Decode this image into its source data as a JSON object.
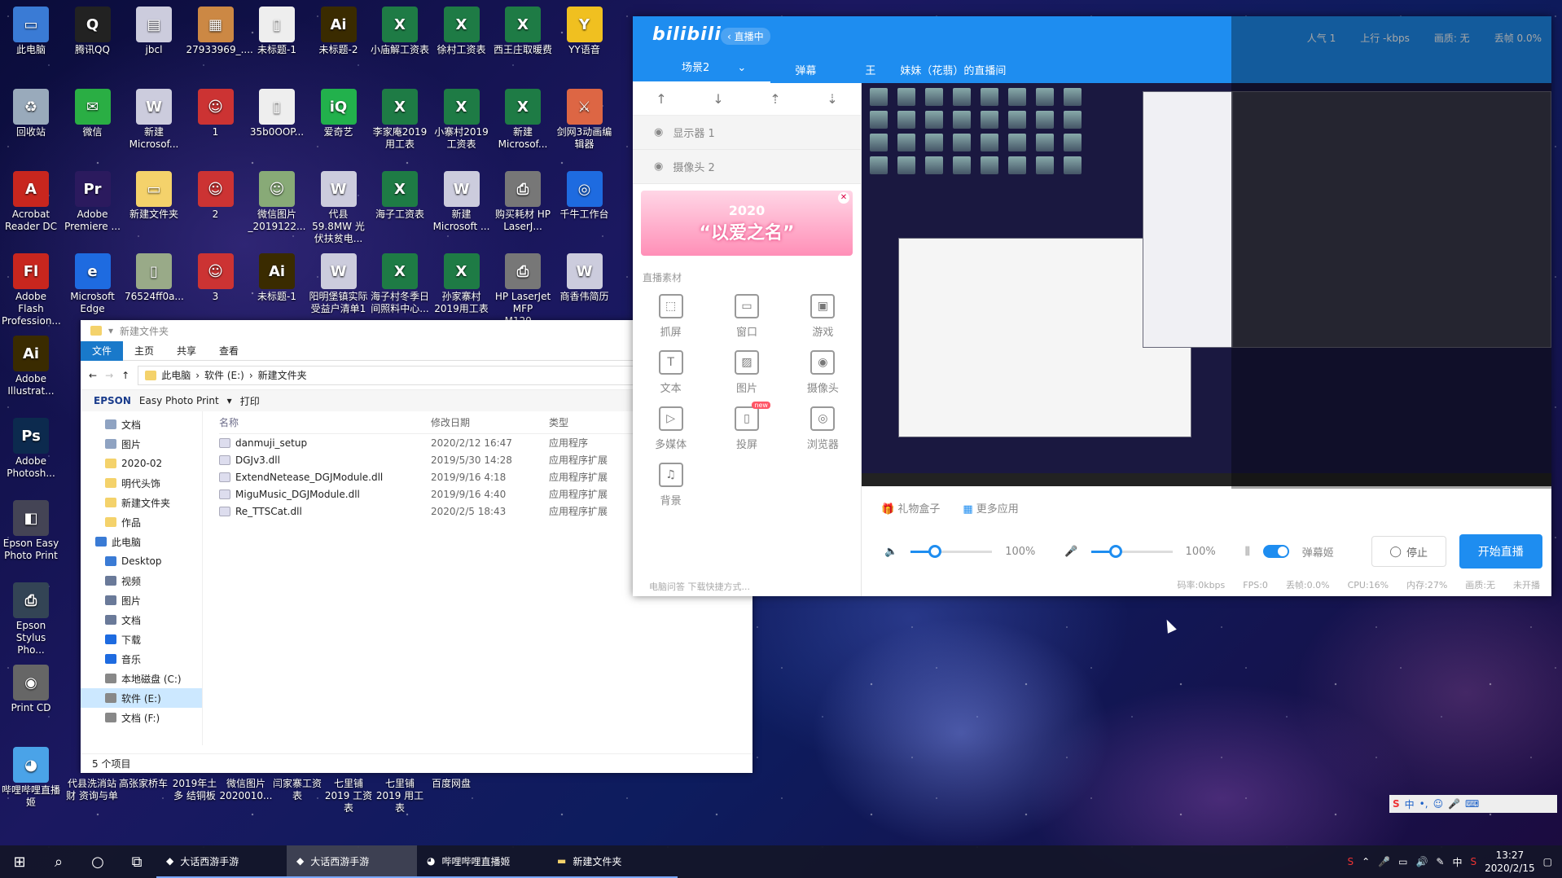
{
  "desktop": {
    "icons": [
      {
        "label": "此电脑",
        "color": "#3a7bd5",
        "glyph": "▭",
        "col": 0,
        "row": 0
      },
      {
        "label": "腾讯QQ",
        "color": "#222",
        "glyph": "Q",
        "col": 1,
        "row": 0
      },
      {
        "label": "jbcl",
        "color": "#ccd",
        "glyph": "▤",
        "col": 2,
        "row": 0
      },
      {
        "label": "27933969_....",
        "color": "#c84",
        "glyph": "▦",
        "col": 3,
        "row": 0
      },
      {
        "label": "未标题-1",
        "color": "#eee",
        "glyph": "▯",
        "col": 4,
        "row": 0
      },
      {
        "label": "未标题-2",
        "color": "#3a2b00",
        "glyph": "Ai",
        "col": 5,
        "row": 0
      },
      {
        "label": "小庙解工资表",
        "color": "#1e7b45",
        "glyph": "X",
        "col": 6,
        "row": 0
      },
      {
        "label": "徐村工资表",
        "color": "#1e7b45",
        "glyph": "X",
        "col": 7,
        "row": 0
      },
      {
        "label": "西王庄取暖费",
        "color": "#1e7b45",
        "glyph": "X",
        "col": 8,
        "row": 0
      },
      {
        "label": "YY语音",
        "color": "#f0c020",
        "glyph": "Y",
        "col": 9,
        "row": 0
      },
      {
        "label": "回收站",
        "color": "#9ab",
        "glyph": "♻",
        "col": 0,
        "row": 1
      },
      {
        "label": "微信",
        "color": "#2aae44",
        "glyph": "✉",
        "col": 1,
        "row": 1
      },
      {
        "label": "新建 Microsof...",
        "color": "#ccd",
        "glyph": "W",
        "col": 2,
        "row": 1
      },
      {
        "label": "1",
        "color": "#c33",
        "glyph": "☺",
        "col": 3,
        "row": 1
      },
      {
        "label": "35b0OOP...",
        "color": "#eee",
        "glyph": "▯",
        "col": 4,
        "row": 1
      },
      {
        "label": "爱奇艺",
        "color": "#22b14c",
        "glyph": "iQ",
        "col": 5,
        "row": 1
      },
      {
        "label": "李家庵2019 用工表",
        "color": "#1e7b45",
        "glyph": "X",
        "col": 6,
        "row": 1
      },
      {
        "label": "小寨村2019 工资表",
        "color": "#1e7b45",
        "glyph": "X",
        "col": 7,
        "row": 1
      },
      {
        "label": "新建 Microsof...",
        "color": "#1e7b45",
        "glyph": "X",
        "col": 8,
        "row": 1
      },
      {
        "label": "剑网3动画编 辑器",
        "color": "#d64",
        "glyph": "⚔",
        "col": 9,
        "row": 1
      },
      {
        "label": "Acrobat Reader DC",
        "color": "#c8261e",
        "glyph": "A",
        "col": 0,
        "row": 2
      },
      {
        "label": "Adobe Premiere ...",
        "color": "#2b1a5e",
        "glyph": "Pr",
        "col": 1,
        "row": 2
      },
      {
        "label": "新建文件夹",
        "color": "#f4d26b",
        "glyph": "▭",
        "col": 2,
        "row": 2
      },
      {
        "label": "2",
        "color": "#c33",
        "glyph": "☺",
        "col": 3,
        "row": 2
      },
      {
        "label": "微信图片 _2019122...",
        "color": "#8a7",
        "glyph": "☺",
        "col": 4,
        "row": 2
      },
      {
        "label": "代县59.8MW 光伏扶贫电...",
        "color": "#ccd",
        "glyph": "W",
        "col": 5,
        "row": 2
      },
      {
        "label": "海子工资表",
        "color": "#1e7b45",
        "glyph": "X",
        "col": 6,
        "row": 2
      },
      {
        "label": "新建 Microsoft ...",
        "color": "#ccd",
        "glyph": "W",
        "col": 7,
        "row": 2
      },
      {
        "label": "购买耗材 HP LaserJ...",
        "color": "#777",
        "glyph": "⎙",
        "col": 8,
        "row": 2
      },
      {
        "label": "千牛工作台",
        "color": "#1e6be0",
        "glyph": "◎",
        "col": 9,
        "row": 2
      },
      {
        "label": "Adobe Flash Profession...",
        "color": "#c8261e",
        "glyph": "Fl",
        "col": 0,
        "row": 3
      },
      {
        "label": "Microsoft Edge",
        "color": "#1e6be0",
        "glyph": "e",
        "col": 1,
        "row": 3
      },
      {
        "label": "76524ff0a...",
        "color": "#9a8",
        "glyph": "▯",
        "col": 2,
        "row": 3
      },
      {
        "label": "3",
        "color": "#c33",
        "glyph": "☺",
        "col": 3,
        "row": 3
      },
      {
        "label": "未标题-1",
        "color": "#3a2b00",
        "glyph": "Ai",
        "col": 4,
        "row": 3
      },
      {
        "label": "阳明堡镇实际 受益户清单1",
        "color": "#ccd",
        "glyph": "W",
        "col": 5,
        "row": 3
      },
      {
        "label": "海子村冬季日 间照料中心...",
        "color": "#1e7b45",
        "glyph": "X",
        "col": 6,
        "row": 3
      },
      {
        "label": "孙家寨村 2019用工表",
        "color": "#1e7b45",
        "glyph": "X",
        "col": 7,
        "row": 3
      },
      {
        "label": "HP LaserJet MFP M129...",
        "color": "#777",
        "glyph": "⎙",
        "col": 8,
        "row": 3
      },
      {
        "label": "商香伟简历",
        "color": "#ccd",
        "glyph": "W",
        "col": 9,
        "row": 3
      },
      {
        "label": "Adobe Illustrat...",
        "color": "#3a2b00",
        "glyph": "Ai",
        "col": 0,
        "row": 4
      },
      {
        "label": "Adobe Photosh...",
        "color": "#0c2a4e",
        "glyph": "Ps",
        "col": 0,
        "row": 5
      },
      {
        "label": "Epson Easy Photo Print",
        "color": "#445",
        "glyph": "◧",
        "col": 0,
        "row": 6
      },
      {
        "label": "Epson Stylus Pho...",
        "color": "#345",
        "glyph": "⎙",
        "col": 0,
        "row": 7
      },
      {
        "label": "Print CD",
        "color": "#666",
        "glyph": "◉",
        "col": 0,
        "row": 8
      },
      {
        "label": "哔哩哔哩直播 姬",
        "color": "#4aa3e8",
        "glyph": "◕",
        "col": 0,
        "row": 9
      }
    ],
    "bottom_icons": [
      "代县洗消站财 资询与单",
      "高张家桥车",
      "2019年土多 结铜板",
      "微信图片 2020010...",
      "闫家寨工资表",
      "七里铺2019 工资表",
      "七里铺2019 用工表",
      "百度网盘"
    ]
  },
  "explorer": {
    "title": "新建文件夹",
    "ribbon_tabs": [
      "文件",
      "主页",
      "共享",
      "查看"
    ],
    "path": [
      "此电脑",
      "软件 (E:)",
      "新建文件夹"
    ],
    "toolbar_brand": "EPSON",
    "toolbar_app": "Easy Photo Print",
    "toolbar_print": "打印",
    "nav": [
      {
        "label": "文档",
        "color": "#8fa3c2"
      },
      {
        "label": "图片",
        "color": "#8fa3c2"
      },
      {
        "label": "2020-02",
        "color": "#f4d26b"
      },
      {
        "label": "明代头饰",
        "color": "#f4d26b"
      },
      {
        "label": "新建文件夹",
        "color": "#f4d26b"
      },
      {
        "label": "作品",
        "color": "#f4d26b"
      },
      {
        "label": "此电脑",
        "color": "#3a7bd5"
      },
      {
        "label": "Desktop",
        "color": "#3a7bd5"
      },
      {
        "label": "视频",
        "color": "#6a7a99"
      },
      {
        "label": "图片",
        "color": "#6a7a99"
      },
      {
        "label": "文档",
        "color": "#6a7a99"
      },
      {
        "label": "下载",
        "color": "#1e6be0"
      },
      {
        "label": "音乐",
        "color": "#1e6be0"
      },
      {
        "label": "本地磁盘 (C:)",
        "color": "#888"
      },
      {
        "label": "软件 (E:)",
        "color": "#888"
      },
      {
        "label": "文档 (F:)",
        "color": "#888"
      }
    ],
    "columns": [
      "名称",
      "修改日期",
      "类型"
    ],
    "files": [
      {
        "name": "danmuji_setup",
        "date": "2020/2/12 16:47",
        "type": "应用程序"
      },
      {
        "name": "DGJv3.dll",
        "date": "2019/5/30 14:28",
        "type": "应用程序扩展"
      },
      {
        "name": "ExtendNetease_DGJModule.dll",
        "date": "2019/9/16 4:18",
        "type": "应用程序扩展"
      },
      {
        "name": "MiguMusic_DGJModule.dll",
        "date": "2019/9/16 4:40",
        "type": "应用程序扩展"
      },
      {
        "name": "Re_TTSCat.dll",
        "date": "2020/2/5 18:43",
        "type": "应用程序扩展"
      }
    ],
    "status": "5 个项目"
  },
  "live": {
    "logo": "bilibili",
    "back_label": "直播中",
    "stats": [
      "人气 1",
      "上行 -kbps",
      "画质: 无",
      "丢帧 0.0%"
    ],
    "scenes": [
      "场景2",
      "弹幕",
      "王"
    ],
    "room_title": "妹妹（花翡）的直播间",
    "sources": [
      "显示器 1",
      "摄像头 2"
    ],
    "banner_year": "2020",
    "banner_text": "“以爱之名”",
    "materials_title": "直播素材",
    "materials": [
      {
        "label": "抓屏",
        "glyph": "⬚"
      },
      {
        "label": "窗口",
        "glyph": "▭"
      },
      {
        "label": "游戏",
        "glyph": "▣"
      },
      {
        "label": "文本",
        "glyph": "T"
      },
      {
        "label": "图片",
        "glyph": "▨"
      },
      {
        "label": "摄像头",
        "glyph": "◉"
      },
      {
        "label": "多媒体",
        "glyph": "▷"
      },
      {
        "label": "投屏",
        "glyph": "▯"
      },
      {
        "label": "浏览器",
        "glyph": "◎"
      },
      {
        "label": "背景",
        "glyph": "♫"
      }
    ],
    "new_badge": "new",
    "left_footer": "电脑问答 下载快捷方式...",
    "gift_box": "礼物盒子",
    "more_apps": "更多应用",
    "volume_1": "100%",
    "volume_2": "100%",
    "volume_1_level": 0.3,
    "volume_2_level": 0.3,
    "beauty_label": "弹幕姬",
    "stop_label": "停止",
    "start_label": "开始直播",
    "status_items": [
      "码率:0kbps",
      "FPS:0",
      "丢帧:0.0%",
      "CPU:16%",
      "内存:27%",
      "画质:无",
      "未开播"
    ]
  },
  "taskbar": {
    "apps": [
      "大话西游手游",
      "大话西游手游",
      "哔哩哔哩直播姬",
      "新建文件夹"
    ],
    "time": "13:27",
    "date": "2020/2/15",
    "ime": "中"
  }
}
